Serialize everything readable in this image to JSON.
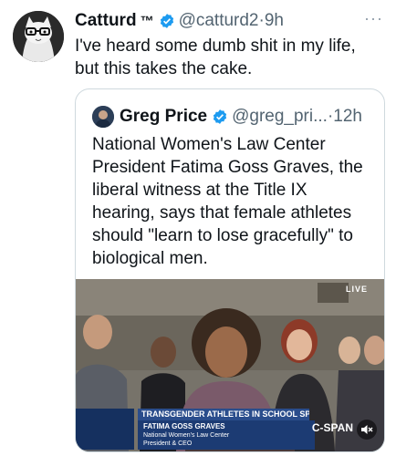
{
  "tweet": {
    "name": "Catturd",
    "tm": "™",
    "handle": "@catturd2",
    "separator": "·",
    "time": "9h",
    "more": "···",
    "lines": [
      "I've heard some dumb shit in my life,",
      "but this takes the cake."
    ]
  },
  "quote": {
    "name": "Greg Price",
    "handle": "@greg_pri...",
    "separator": "·",
    "time": "12h",
    "lines": [
      "National Women's Law Center",
      "President Fatima Goss Graves, the",
      "liberal witness at the Title IX",
      "hearing, says that female athletes",
      "should \"learn to lose gracefully\" to",
      "biological men."
    ],
    "media": {
      "live": "LIVE",
      "banner": "TRANSGENDER ATHLETES IN SCHOOL SPORTS",
      "speaker": "FATIMA GOSS GRAVES",
      "org": "National Women's Law Center",
      "role": "President & CEO",
      "network": "C-SPAN"
    }
  },
  "colors": {
    "verified": "#1d9bf0",
    "text": "#0f1419",
    "muted": "#536471"
  }
}
